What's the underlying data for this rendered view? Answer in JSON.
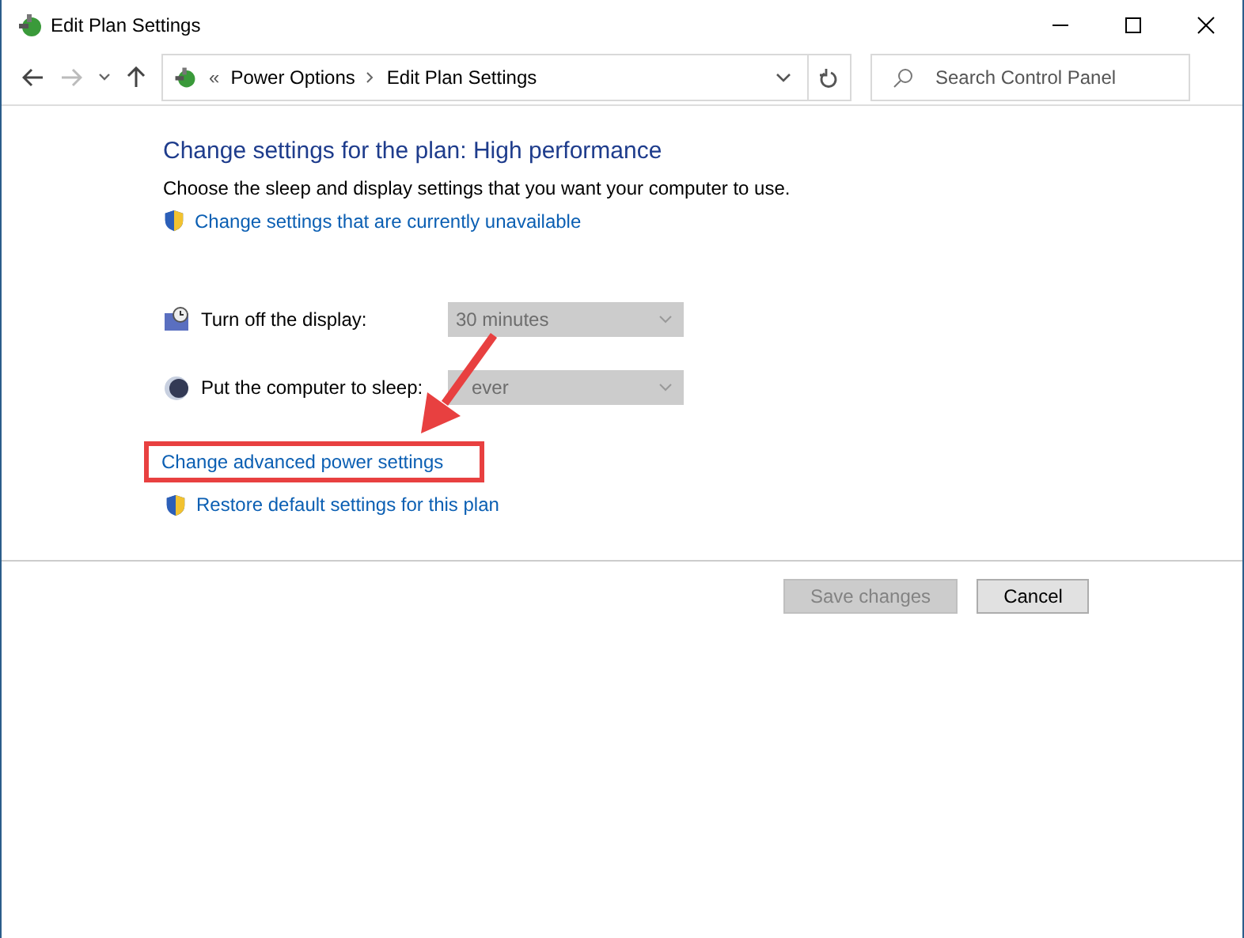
{
  "window": {
    "title": "Edit Plan Settings"
  },
  "address_bar": {
    "breadcrumbs": [
      "Power Options",
      "Edit Plan Settings"
    ],
    "separator": "«"
  },
  "search": {
    "placeholder": "Search Control Panel"
  },
  "heading": "Change settings for the plan: High performance",
  "description": "Choose the sleep and display settings that you want your computer to use.",
  "unavailable_link": "Change settings that are currently unavailable",
  "settings": [
    {
      "kind": "display",
      "label": "Turn off the display:",
      "value": "30 minutes",
      "disabled": true
    },
    {
      "kind": "sleep",
      "label": "Put the computer to sleep:",
      "value": "ever",
      "disabled": true
    }
  ],
  "links": [
    {
      "label": "Change advanced power settings",
      "shield": false,
      "highlighted": true
    },
    {
      "label": "Restore default settings for this plan",
      "shield": true,
      "highlighted": false
    }
  ],
  "buttons": [
    {
      "label": "Save changes",
      "disabled": true
    },
    {
      "label": "Cancel",
      "disabled": false
    }
  ]
}
